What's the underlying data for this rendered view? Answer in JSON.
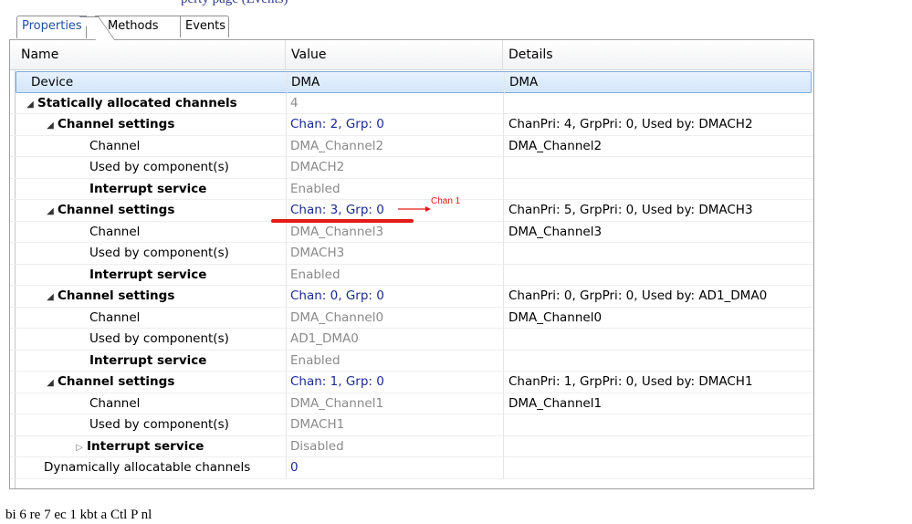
{
  "caption_top": "perty page (Events)",
  "caption_bottom": "bi 6 re 7 ec 1 kbt a Ctl P  nl",
  "tabs": [
    {
      "label": "Properties",
      "active": true
    },
    {
      "label": "Methods",
      "active": false
    },
    {
      "label": "Events",
      "active": false
    }
  ],
  "columns": {
    "name": "Name",
    "value": "Value",
    "details": "Details"
  },
  "rows": [
    {
      "name": "Device",
      "value": "DMA",
      "details": "DMA"
    },
    {
      "name": "Statically allocated channels",
      "value": "4",
      "details": ""
    },
    {
      "name": "Channel settings",
      "value": "Chan: 2, Grp: 0",
      "details": "ChanPri: 4, GrpPri: 0, Used by: DMACH2"
    },
    {
      "name": "Channel",
      "value": "DMA_Channel2",
      "details": "DMA_Channel2"
    },
    {
      "name": "Used by component(s)",
      "value": "DMACH2",
      "details": ""
    },
    {
      "name": "Interrupt service",
      "value": "Enabled",
      "details": ""
    },
    {
      "name": "Channel settings",
      "value": "Chan: 3, Grp: 0",
      "details": "ChanPri: 5, GrpPri: 0, Used by: DMACH3"
    },
    {
      "name": "Channel",
      "value": "DMA_Channel3",
      "details": "DMA_Channel3"
    },
    {
      "name": "Used by component(s)",
      "value": "DMACH3",
      "details": ""
    },
    {
      "name": "Interrupt service",
      "value": "Enabled",
      "details": ""
    },
    {
      "name": "Channel settings",
      "value": "Chan: 0, Grp: 0",
      "details": "ChanPri: 0, GrpPri: 0, Used by: AD1_DMA0"
    },
    {
      "name": "Channel",
      "value": "DMA_Channel0",
      "details": "DMA_Channel0"
    },
    {
      "name": "Used by component(s)",
      "value": "AD1_DMA0",
      "details": ""
    },
    {
      "name": "Interrupt service",
      "value": "Enabled",
      "details": ""
    },
    {
      "name": "Channel settings",
      "value": "Chan: 1, Grp: 0",
      "details": "ChanPri: 1, GrpPri: 0, Used by: DMACH1"
    },
    {
      "name": "Channel",
      "value": "DMA_Channel1",
      "details": "DMA_Channel1"
    },
    {
      "name": "Used by component(s)",
      "value": "DMACH1",
      "details": ""
    },
    {
      "name": "Interrupt service",
      "value": "Disabled",
      "details": ""
    },
    {
      "name": "Dynamically allocatable channels",
      "value": "0",
      "details": ""
    }
  ],
  "annotation": {
    "label": "Chan 1",
    "color": "#e51a1a"
  },
  "colors": {
    "link_blue": "#1a2b8f",
    "disabled_gray": "#8a8a8a",
    "tab_active": "#1e50a2",
    "selection": "#d3e6fa"
  },
  "icons": {
    "expanded": "triangle-down-icon",
    "collapsed": "triangle-right-icon"
  }
}
